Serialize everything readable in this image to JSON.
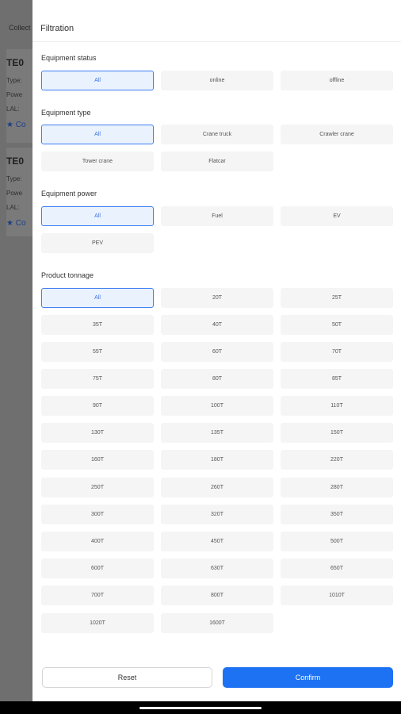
{
  "background": {
    "tab_label": "Collect",
    "cards": [
      {
        "code": "TE0",
        "lines": [
          "Type:",
          "Powe",
          "LAL:"
        ],
        "star_label": "Co"
      },
      {
        "code": "TE0",
        "lines": [
          "Type:",
          "Powe",
          "LAL:"
        ],
        "star_label": "Co"
      }
    ]
  },
  "drawer": {
    "title": "Filtration",
    "sections": [
      {
        "label": "Equipment status",
        "options": [
          "All",
          "online",
          "offline"
        ],
        "selected": "All"
      },
      {
        "label": "Equipment type",
        "options": [
          "All",
          "Crane truck",
          "Crawler crane",
          "Tower crane",
          "Flatcar"
        ],
        "selected": "All"
      },
      {
        "label": "Equipment power",
        "options": [
          "All",
          "Fuel",
          "EV",
          "PEV"
        ],
        "selected": "All"
      },
      {
        "label": "Product tonnage",
        "options": [
          "All",
          "20T",
          "25T",
          "35T",
          "40T",
          "50T",
          "55T",
          "60T",
          "70T",
          "75T",
          "80T",
          "85T",
          "90T",
          "100T",
          "110T",
          "130T",
          "135T",
          "150T",
          "160T",
          "180T",
          "220T",
          "250T",
          "260T",
          "280T",
          "300T",
          "320T",
          "350T",
          "400T",
          "450T",
          "500T",
          "600T",
          "630T",
          "650T",
          "700T",
          "800T",
          "1010T",
          "1020T",
          "1600T"
        ],
        "selected": "All"
      }
    ],
    "reset_label": "Reset",
    "confirm_label": "Confirm"
  },
  "colors": {
    "accent": "#1d72f3",
    "selected_bg": "#eaf2fe",
    "selected_border": "#3e7ef0",
    "chip_bg": "#f5f5f5",
    "overlay": "#6f6f6f"
  },
  "icons": {
    "star": "star-icon"
  }
}
